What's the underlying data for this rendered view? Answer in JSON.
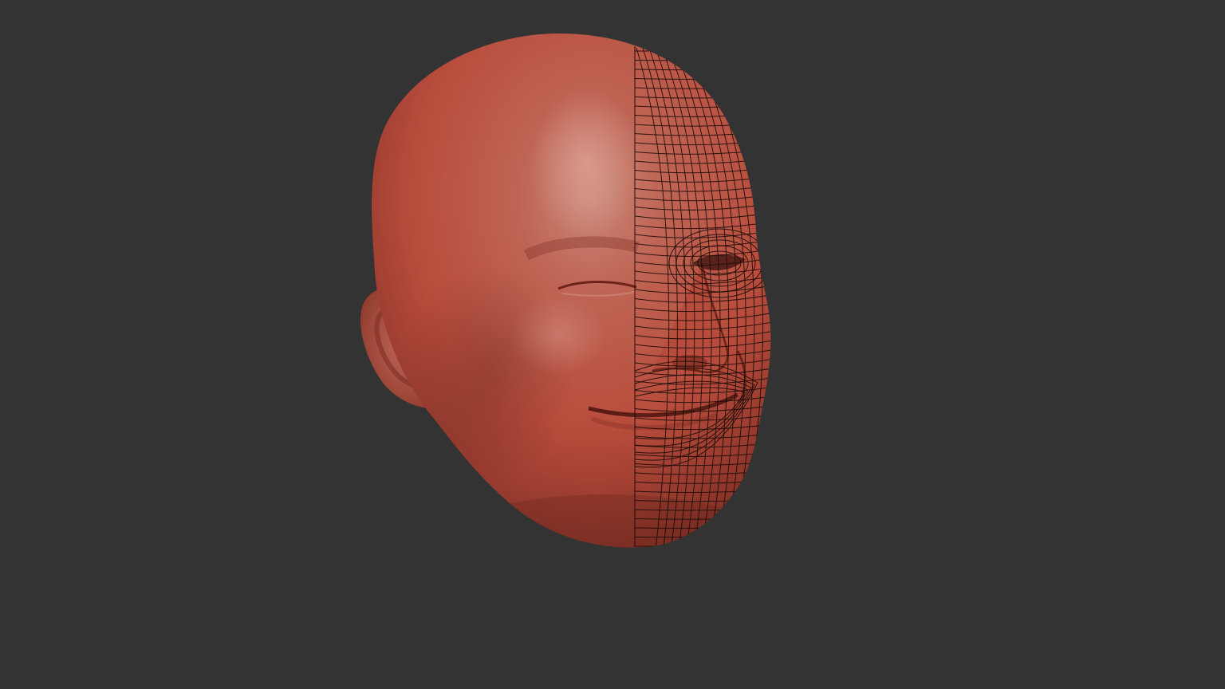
{
  "viewport": {
    "background_color": "#333333"
  },
  "model": {
    "subject": "sculpted head",
    "material_color": "#b84c3c",
    "highlight_color": "#c98677",
    "shadow_color": "#7a2c22",
    "wireframe_color": "#1c0c08",
    "wireframe_side": "right"
  }
}
